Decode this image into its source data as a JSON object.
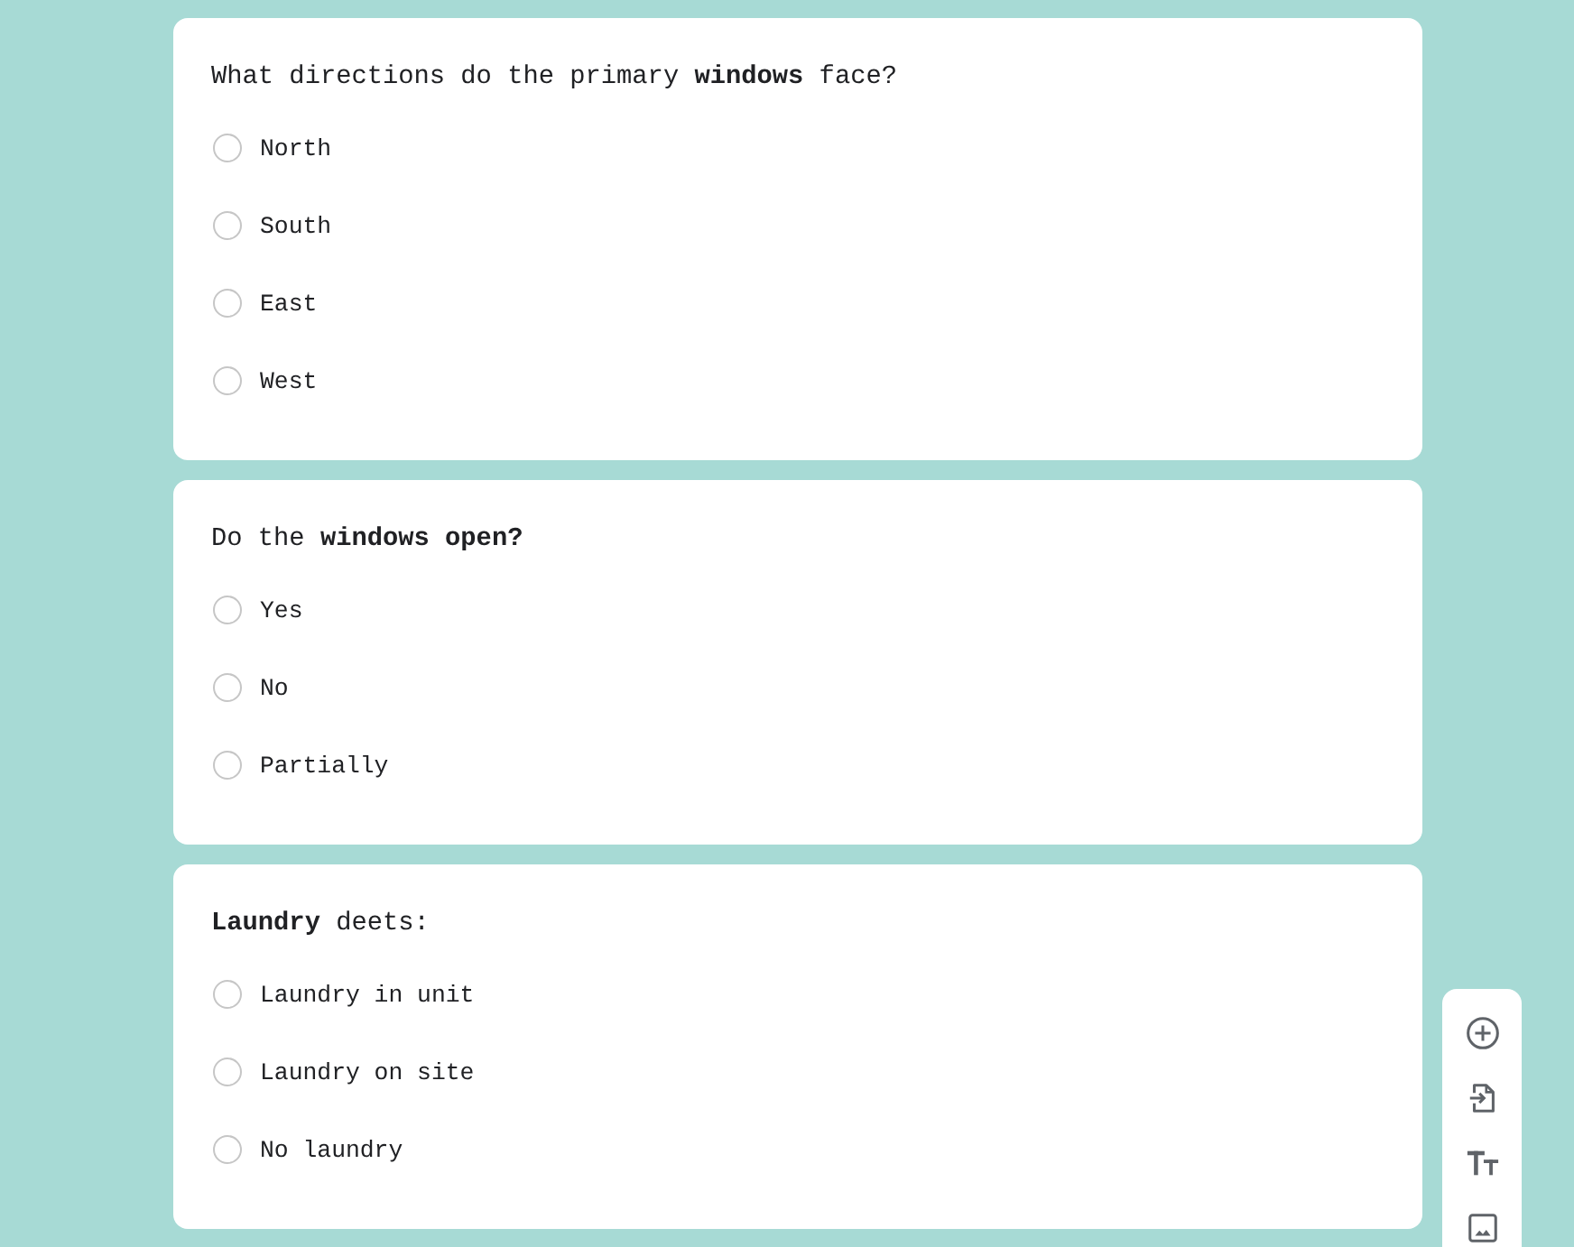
{
  "questions": [
    {
      "title": "What directions do the primary **windows** face?",
      "options": [
        {
          "label": "North",
          "selected": false
        },
        {
          "label": "South",
          "selected": false
        },
        {
          "label": "East",
          "selected": false
        },
        {
          "label": "West",
          "selected": false
        }
      ]
    },
    {
      "title": "Do the **windows open?**",
      "options": [
        {
          "label": "Yes",
          "selected": false
        },
        {
          "label": "No",
          "selected": false
        },
        {
          "label": "Partially",
          "selected": false
        }
      ]
    },
    {
      "title": "**Laundry** deets:",
      "options": [
        {
          "label": "Laundry in unit",
          "selected": false
        },
        {
          "label": "Laundry on site",
          "selected": false
        },
        {
          "label": "No laundry",
          "selected": false
        }
      ]
    }
  ]
}
